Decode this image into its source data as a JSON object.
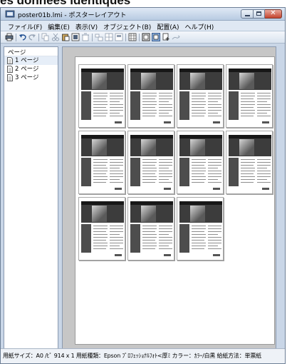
{
  "caption": {
    "text": "es données identiques"
  },
  "window": {
    "title": "poster01b.lmi - ポスターレイアウト",
    "controls": {
      "minimize": "minimize-icon",
      "maximize": "maximize-icon",
      "close": "✕"
    }
  },
  "menu": [
    "ファイル(F)",
    "編集(E)",
    "表示(V)",
    "オブジェクト(B)",
    "配置(A)",
    "ヘルプ(H)"
  ],
  "toolbar": {
    "icons": [
      "print-icon",
      "undo-icon",
      "redo-icon",
      "copy-icon",
      "cut-icon",
      "paste-icon",
      "duplicate-icon",
      "delete-icon",
      "align-icon",
      "distribute-icon",
      "layout-icon",
      "grid-icon",
      "page-view-icon",
      "page-preview-icon",
      "add-page-icon",
      "tool-icon"
    ]
  },
  "page_panel": {
    "header": "ページ",
    "items": [
      {
        "label": "1 ページ",
        "selected": true
      },
      {
        "label": "2 ページ",
        "selected": false
      },
      {
        "label": "3 ページ",
        "selected": false
      }
    ]
  },
  "canvas": {
    "tile_rows": [
      4,
      4,
      3
    ],
    "tile_count": 11
  },
  "status": {
    "text": "用紙サイズ：A0 /ﾋﾟ 914 x 1 用紙種類：Epson ﾌﾟﾛﾌｪｯｼｮﾅﾙﾌｫﾄ<厚ﾐ カラー：ｶﾗｰ/白黒 給紙方法：単票紙"
  },
  "colors": {
    "window_frame": "#c9d6e7",
    "canvas_background": "#c6c6c6",
    "close_button": "#c4432d"
  }
}
